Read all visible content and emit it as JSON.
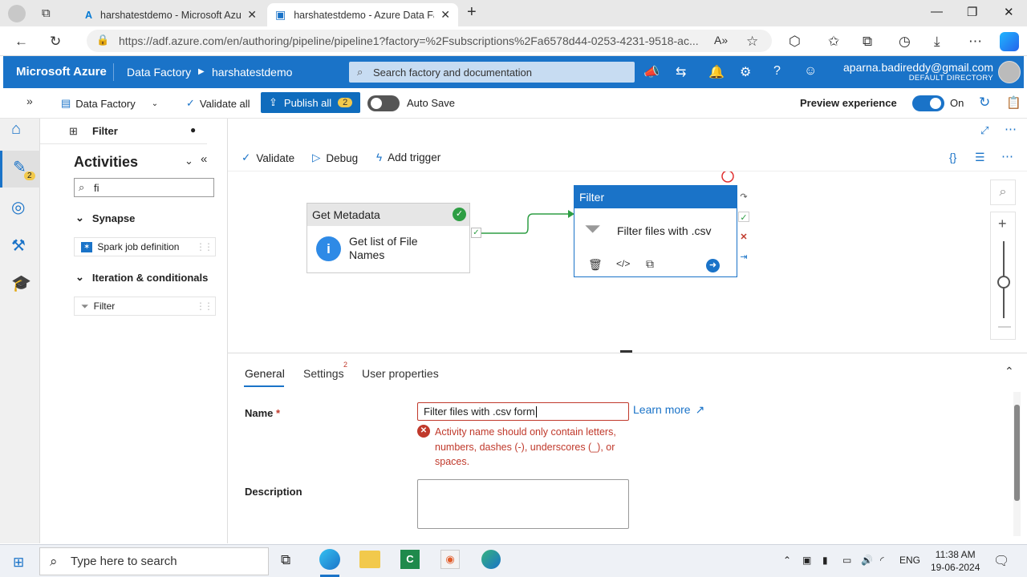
{
  "browser": {
    "tabs": [
      {
        "title": "harshatestdemo - Microsoft Azur"
      },
      {
        "title": "harshatestdemo - Azure Data Fac"
      }
    ],
    "url": "https://adf.azure.com/en/authoring/pipeline/pipeline1?factory=%2Fsubscriptions%2Fa6578d44-0253-4231-9518-ac..."
  },
  "azure_header": {
    "brand": "Microsoft Azure",
    "crumb1": "Data Factory",
    "crumb2": "harshatestdemo",
    "search_placeholder": "Search factory and documentation",
    "user_email": "aparna.badireddy@gmail.com",
    "directory": "DEFAULT DIRECTORY"
  },
  "toolbar": {
    "factory": "Data Factory",
    "validate_all": "Validate all",
    "publish_all": "Publish all",
    "publish_count": "2",
    "auto_save": "Auto Save",
    "preview": "Preview experience",
    "preview_state": "On"
  },
  "left_nav": {
    "pencil_badge": "2"
  },
  "pipeline_tab": {
    "name": "Filter"
  },
  "activities": {
    "heading": "Activities",
    "search_value": "fi",
    "groups": [
      {
        "name": "Synapse",
        "items": [
          "Spark job definition"
        ]
      },
      {
        "name": "Iteration & conditionals",
        "items": [
          "Filter"
        ]
      }
    ]
  },
  "canvas_toolbar": {
    "validate": "Validate",
    "debug": "Debug",
    "add_trigger": "Add trigger"
  },
  "nodes": {
    "get_metadata": {
      "type": "Get Metadata",
      "name": "Get list of File Names"
    },
    "filter": {
      "type": "Filter",
      "name": "Filter files with .csv"
    }
  },
  "properties": {
    "tabs": [
      "General",
      "Settings",
      "User properties"
    ],
    "settings_badge": "2",
    "name_label": "Name",
    "required_mark": "*",
    "name_value": "Filter files with .csv form",
    "learn_more": "Learn more",
    "error": "Activity name should only contain letters, numbers, dashes (-), underscores (_), or spaces.",
    "description_label": "Description",
    "description_value": ""
  },
  "taskbar": {
    "search_placeholder": "Type here to search",
    "lang": "ENG",
    "time": "11:38 AM",
    "date": "19-06-2024"
  },
  "colors": {
    "azure_blue": "#1a73c8",
    "error_red": "#c0392b",
    "success_green": "#2e9e44"
  }
}
